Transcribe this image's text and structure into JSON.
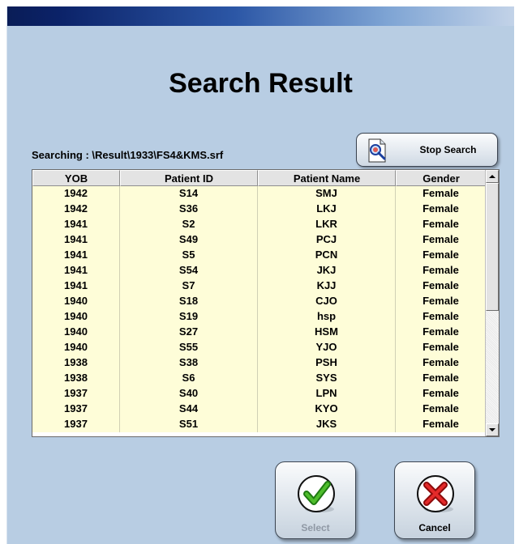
{
  "page": {
    "title": "Search Result",
    "searching_text": "Searching : \\Result\\1933\\FS4&KMS.srf"
  },
  "buttons": {
    "stop_search": "Stop Search",
    "select": "Select",
    "cancel": "Cancel"
  },
  "table": {
    "columns": [
      "YOB",
      "Patient ID",
      "Patient Name",
      "Gender"
    ],
    "rows": [
      [
        "1942",
        "S14",
        "SMJ",
        "Female"
      ],
      [
        "1942",
        "S36",
        "LKJ",
        "Female"
      ],
      [
        "1941",
        "S2",
        "LKR",
        "Female"
      ],
      [
        "1941",
        "S49",
        "PCJ",
        "Female"
      ],
      [
        "1941",
        "S5",
        "PCN",
        "Female"
      ],
      [
        "1941",
        "S54",
        "JKJ",
        "Female"
      ],
      [
        "1941",
        "S7",
        "KJJ",
        "Female"
      ],
      [
        "1940",
        "S18",
        "CJO",
        "Female"
      ],
      [
        "1940",
        "S19",
        "hsp",
        "Female"
      ],
      [
        "1940",
        "S27",
        "HSM",
        "Female"
      ],
      [
        "1940",
        "S55",
        "YJO",
        "Female"
      ],
      [
        "1938",
        "S38",
        "PSH",
        "Female"
      ],
      [
        "1938",
        "S6",
        "SYS",
        "Female"
      ],
      [
        "1937",
        "S40",
        "LPN",
        "Female"
      ],
      [
        "1937",
        "S44",
        "KYO",
        "Female"
      ],
      [
        "1937",
        "S51",
        "JKS",
        "Female"
      ]
    ]
  },
  "colors": {
    "window_bg": "#b8cde3",
    "row_bg": "#fefdd8",
    "titlebar": "#0b2268",
    "select_check": "#3a9a1e",
    "cancel_x": "#d81818"
  },
  "icons": {
    "stop_search": "magnifier-document-icon",
    "select": "checkmark-icon",
    "cancel": "x-icon"
  }
}
